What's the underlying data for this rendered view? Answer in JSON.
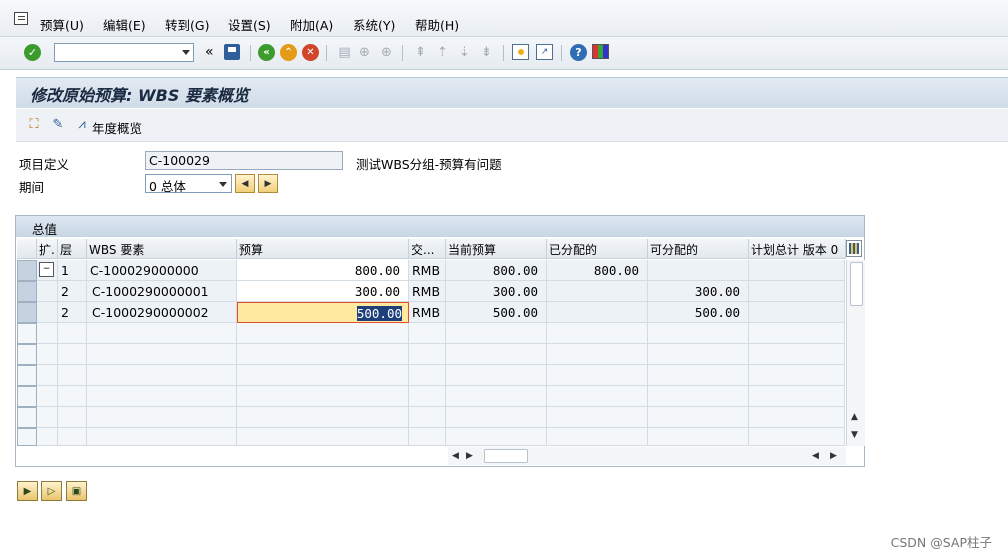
{
  "menu": {
    "items": [
      "预算(U)",
      "编辑(E)",
      "转到(G)",
      "设置(S)",
      "附加(A)",
      "系统(Y)",
      "帮助(H)"
    ]
  },
  "toolbar": {
    "command_value": "",
    "collapse_symbol": "«",
    "icons": [
      "enter-icon",
      "save-icon",
      "back-icon",
      "exit-icon",
      "cancel-icon",
      "print-icon",
      "find-icon",
      "find-next-icon",
      "first-page-icon",
      "previous-page-icon",
      "next-page-icon",
      "last-page-icon",
      "create-session-icon",
      "shortcut-icon",
      "help-icon",
      "layout-icon"
    ]
  },
  "page": {
    "title": "修改原始预算: WBS 要素概览"
  },
  "app_toolbar": {
    "annual_overview_label": "年度概览"
  },
  "form": {
    "project_def_label": "项目定义",
    "project_def_value": "C-100029",
    "project_desc": "测试WBS分组-预算有问题",
    "period_label": "期间",
    "period_value": "0 总体"
  },
  "table": {
    "caption": "总值",
    "columns": [
      "扩.",
      "层",
      "WBS 要素",
      "预算",
      "交...",
      "当前预算",
      "已分配的",
      "可分配的",
      "计划总计",
      "版本 0"
    ],
    "rows": [
      {
        "level": "1",
        "wbs": "C-100029000000",
        "budget": "800.00",
        "currency": "RMB",
        "current": "800.00",
        "distributed": "800.00",
        "distributable": ""
      },
      {
        "level": "2",
        "wbs": "C-1000290000001",
        "budget": "300.00",
        "currency": "RMB",
        "current": "300.00",
        "distributed": "",
        "distributable": "300.00"
      },
      {
        "level": "2",
        "wbs": "C-1000290000002",
        "budget": "500.00",
        "currency": "RMB",
        "current": "500.00",
        "distributed": "",
        "distributable": "500.00"
      }
    ]
  },
  "watermark": "CSDN @SAP柱子"
}
